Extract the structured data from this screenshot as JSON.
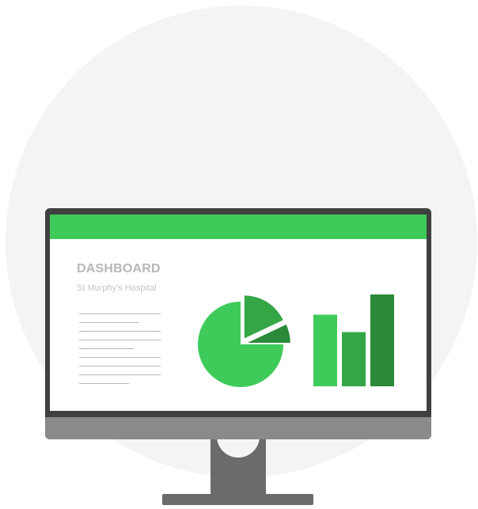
{
  "dashboard": {
    "title": "DASHBOARD",
    "subtitle": "St Murphy's Hospital"
  },
  "colors": {
    "background_circle": "#f4f4f4",
    "monitor_bezel": "#404040",
    "monitor_chin": "#8a8a8a",
    "stand": "#6b6b6b",
    "header_green": "#3ecb5a",
    "green_light": "#3ecb5a",
    "green_mid": "#34a646",
    "green_dark": "#2a8a3a"
  },
  "icons": {
    "pie": "pie-chart-icon",
    "bars": "bar-chart-icon"
  },
  "chart_data": [
    {
      "type": "pie",
      "values": [
        75,
        18,
        7
      ],
      "colors": [
        "#3ecb5a",
        "#34a646",
        "#2a8a3a"
      ],
      "exploded": [
        false,
        true,
        true
      ]
    },
    {
      "type": "bar",
      "values": [
        0.78,
        0.59,
        1.0
      ],
      "colors": [
        "#3ecb5a",
        "#34a646",
        "#2a8a3a"
      ]
    }
  ]
}
